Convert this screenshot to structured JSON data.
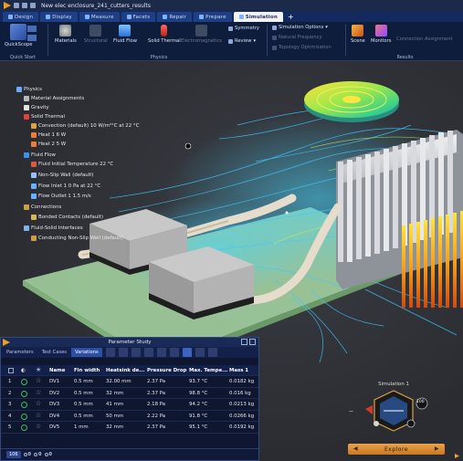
{
  "window": {
    "title": "New elec enclosure_241_cutters_results"
  },
  "tabs": [
    {
      "label": "Design"
    },
    {
      "label": "Display"
    },
    {
      "label": "Measure"
    },
    {
      "label": "Facets"
    },
    {
      "label": "Repair"
    },
    {
      "label": "Prepare"
    },
    {
      "label": "Simulation"
    },
    {
      "label": "+"
    }
  ],
  "ribbon": {
    "quickstart": {
      "button": "QuickScope",
      "group": "Quick Start"
    },
    "physics": {
      "buttons": [
        "Materials",
        "Structural",
        "Fluid Flow",
        "Solid Thermal",
        "Electromagnetics"
      ],
      "small": [
        "Symmetry",
        "Review"
      ],
      "group": "Physics"
    },
    "options": [
      "Simulation Options",
      "Natural Frequency",
      "Topology Optimization"
    ],
    "results": {
      "buttons": [
        "Scene",
        "Monitors"
      ],
      "small": "Connection Assignment",
      "group": "Results"
    }
  },
  "tree": {
    "items": [
      "Physics",
      "Material Assignments",
      "Gravity",
      "Solid Thermal",
      "Convection (default)   10 W/m²°C   at   22 °C",
      "Heat 1      6 W",
      "Heat 2      5 W",
      "Fluid Flow",
      "Fluid Initial Temperature    22 °C",
      "Non-Slip Wall (default)",
      "Flow Inlet 1    0 Pa     at    22 °C",
      "Flow Outlet 1    1.5 m/s",
      "Connections",
      "Bonded Contacts (default)",
      "Fluid-Solid Interfaces",
      "Conducting Non-Slip Wall (default)"
    ]
  },
  "panel": {
    "title": "Parameter Study",
    "tabs": [
      "Parameters",
      "Test Cases",
      "Variations"
    ],
    "columns": [
      "Name",
      "Fin width",
      "Heatsink de...",
      "Pressure Drop",
      "Max. Tempe...",
      "Mass 1"
    ],
    "rows": [
      {
        "idx": "1",
        "name": "DV1",
        "fin": "0.5 mm",
        "hs": "32.00 mm",
        "pd": "2.37 Pa",
        "mt": "93.7 °C",
        "mass": "0.0182 kg"
      },
      {
        "idx": "2",
        "name": "DV2",
        "fin": "0.5 mm",
        "hs": "32 mm",
        "pd": "2.37 Pa",
        "mt": "98.8 °C",
        "mass": "0.016 kg"
      },
      {
        "idx": "3",
        "name": "DV3",
        "fin": "0.5 mm",
        "hs": "41 mm",
        "pd": "2.18 Pa",
        "mt": "94.2 °C",
        "mass": "0.0213 kg"
      },
      {
        "idx": "4",
        "name": "DV4",
        "fin": "0.5 mm",
        "hs": "50 mm",
        "pd": "2.22 Pa",
        "mt": "91.8 °C",
        "mass": "0.0266 kg"
      },
      {
        "idx": "5",
        "name": "DV5",
        "fin": "1 mm",
        "hs": "32 mm",
        "pd": "2.37 Pa",
        "mt": "95.1 °C",
        "mass": "0.0192 kg"
      }
    ],
    "footer": {
      "count": "106",
      "a": "0",
      "b": "0",
      "c": "0"
    }
  },
  "sim": {
    "label": "Simulation 1",
    "badge": "100",
    "button": "Explore"
  }
}
